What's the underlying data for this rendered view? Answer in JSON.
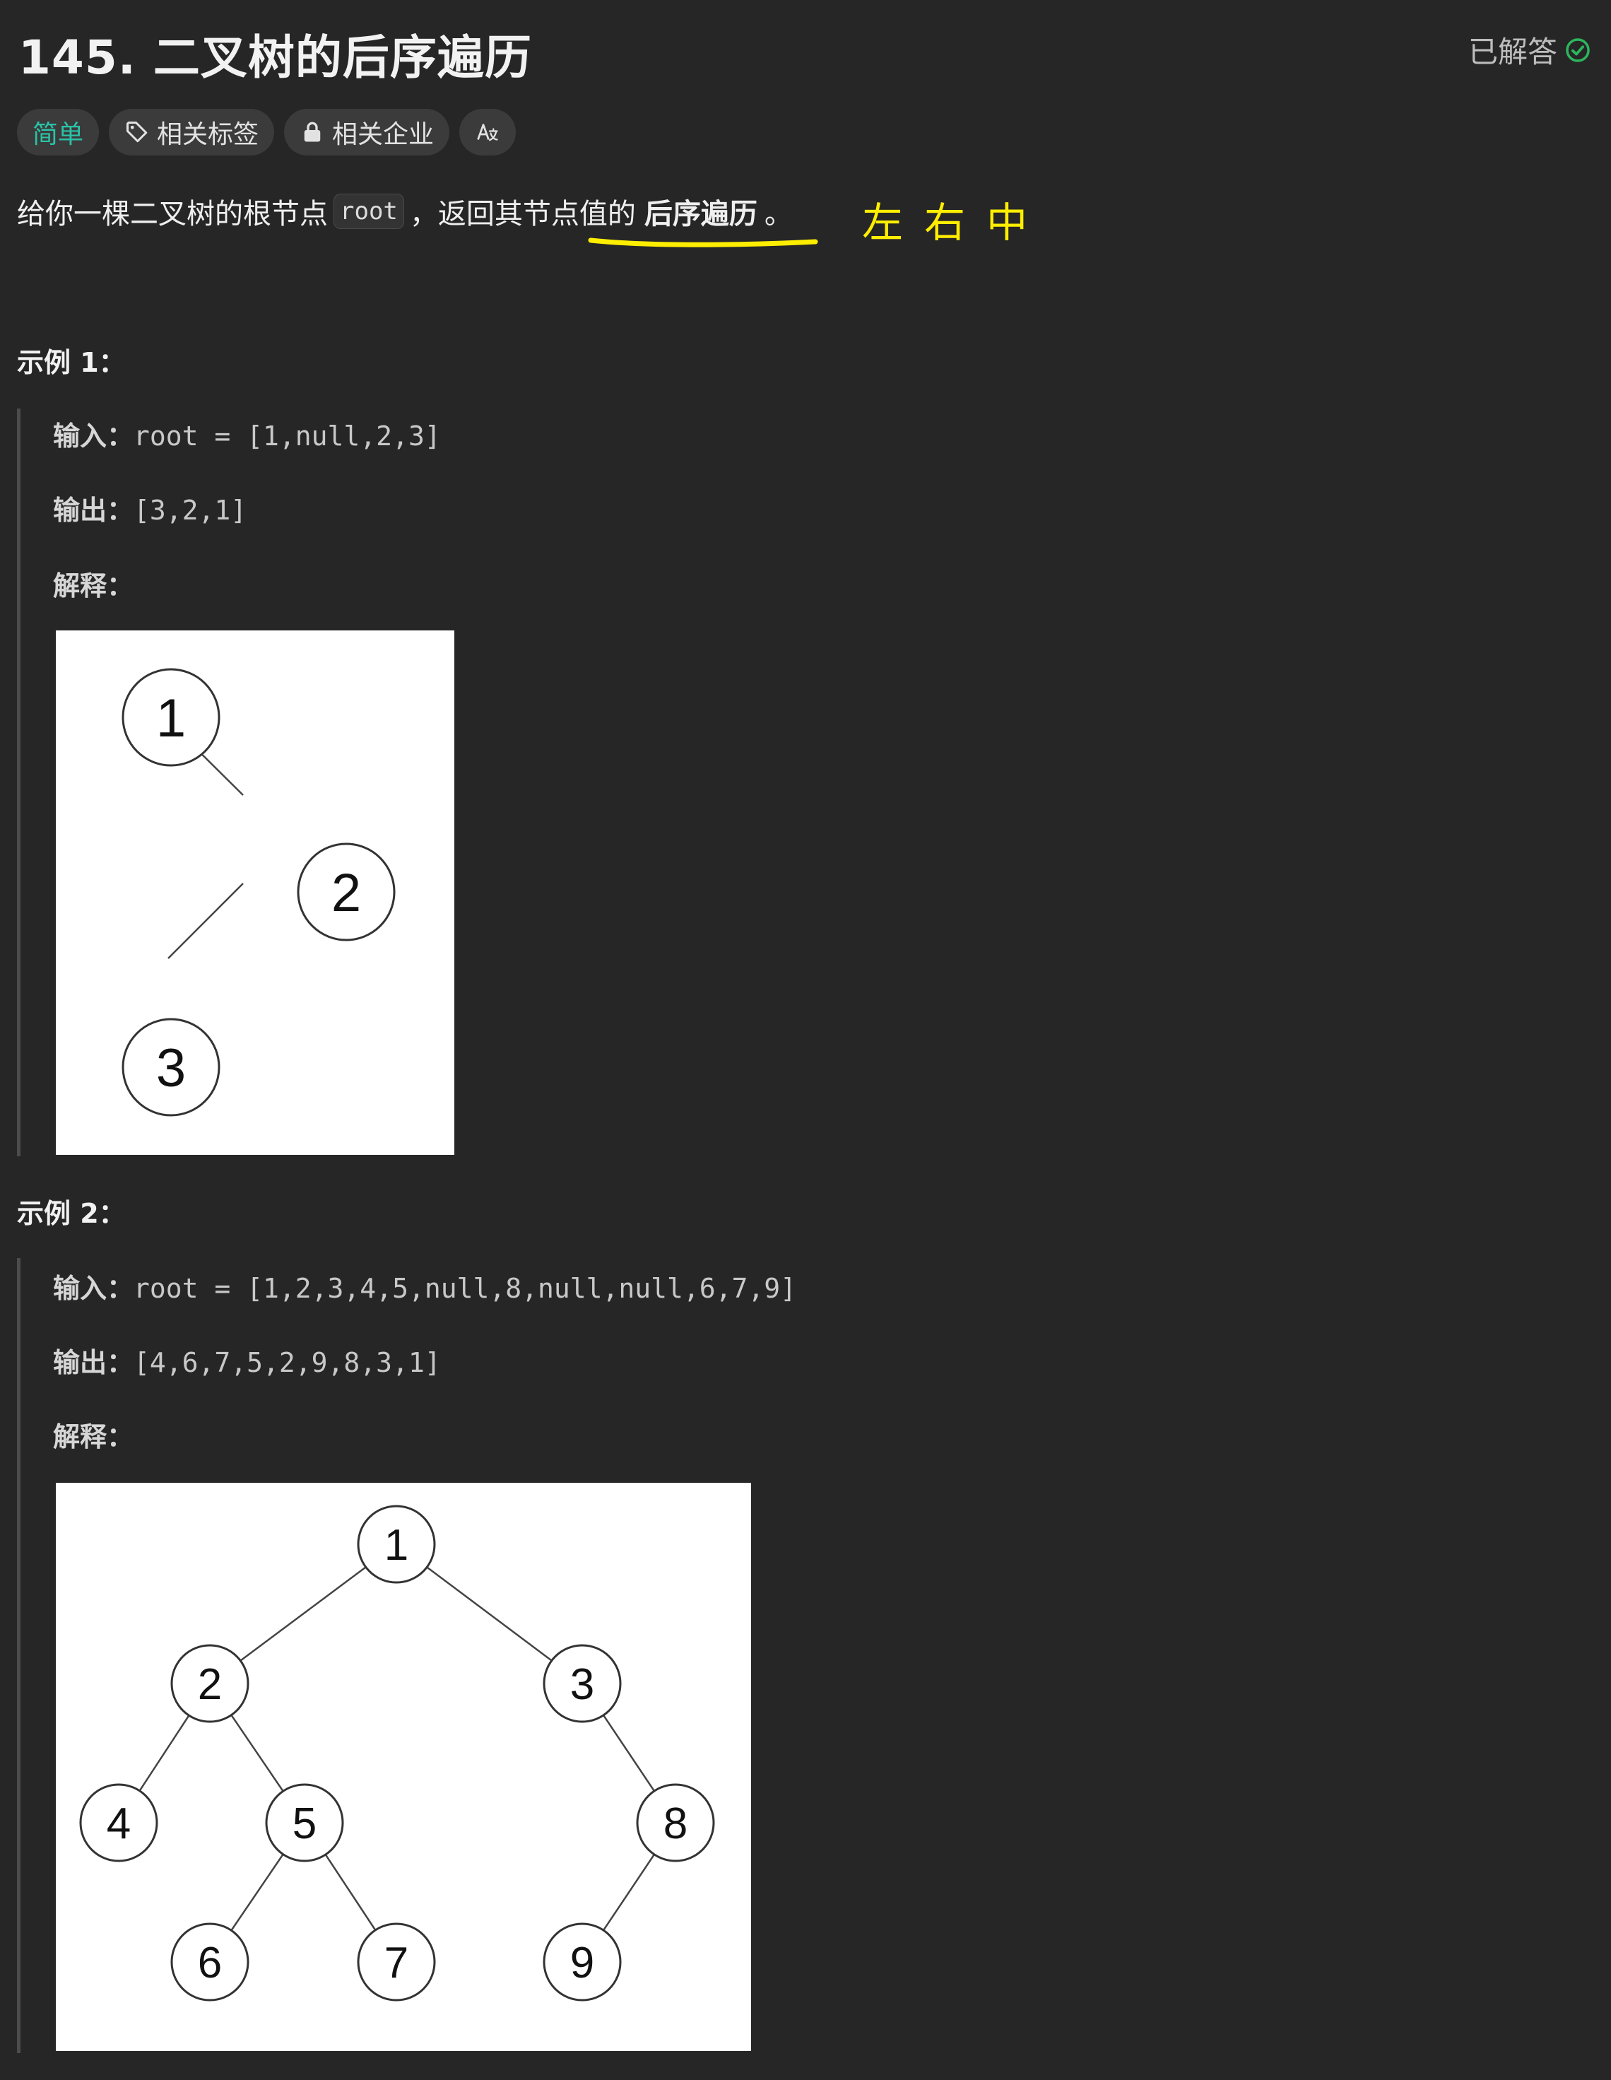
{
  "problem": {
    "title": "145. 二叉树的后序遍历",
    "status": "已解答",
    "tags": [
      {
        "label": "简单",
        "icon": ""
      },
      {
        "label": "相关标签",
        "icon": "tag-icon"
      },
      {
        "label": "相关企业",
        "icon": "lock-icon"
      },
      {
        "label": "Aあ",
        "icon": "translate-icon"
      }
    ],
    "description": {
      "prefix": "给你一棵二叉树的根节点",
      "code": "root",
      "middle": "，返回其节点值的",
      "bold": "后序遍历",
      "suffix": "。"
    },
    "annotation": "左右中",
    "colors": {
      "easy": "#2ac3a8",
      "solved_check": "#2db55d",
      "annotation": "#ffee00"
    }
  },
  "examples": [
    {
      "title": "示例 1：",
      "input_label": "输入：",
      "input_value": "root = [1,null,2,3]",
      "output_label": "输出：",
      "output_value": "[3,2,1]",
      "explain_label": "解释：",
      "tree": {
        "nodes": [
          "1",
          "2",
          "3"
        ],
        "edges": [
          [
            "1",
            "2"
          ],
          [
            "2",
            "3"
          ]
        ]
      }
    },
    {
      "title": "示例 2：",
      "input_label": "输入：",
      "input_value": "root = [1,2,3,4,5,null,8,null,null,6,7,9]",
      "output_label": "输出：",
      "output_value": "[4,6,7,5,2,9,8,3,1]",
      "explain_label": "解释：",
      "tree": {
        "nodes": [
          "1",
          "2",
          "3",
          "4",
          "5",
          "8",
          "6",
          "7",
          "9"
        ],
        "edges": [
          [
            "1",
            "2"
          ],
          [
            "1",
            "3"
          ],
          [
            "2",
            "4"
          ],
          [
            "2",
            "5"
          ],
          [
            "3",
            "8"
          ],
          [
            "5",
            "6"
          ],
          [
            "5",
            "7"
          ],
          [
            "8",
            "9"
          ]
        ]
      }
    }
  ]
}
